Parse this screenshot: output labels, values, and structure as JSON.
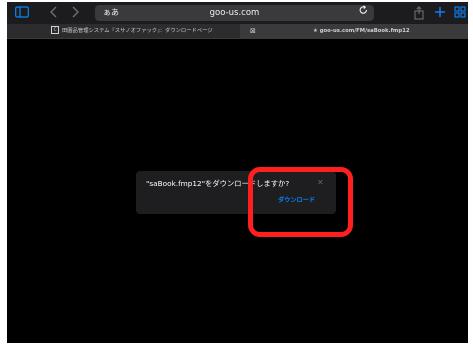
{
  "toolbar": {
    "address_aa": "ぁあ",
    "url": "goo-us.com",
    "icons": {
      "sidebar": "sidebar-icon",
      "back": "chevron-left-icon",
      "forward": "chevron-right-icon",
      "reload": "reload-icon",
      "share": "share-icon",
      "new_tab": "plus-icon",
      "tabs": "tabs-grid-icon"
    }
  },
  "tabs": [
    {
      "title": "田園品管理システム『スサノオファック』：ダウンロードページ",
      "active": false
    },
    {
      "title": "goo-us.com/FM/saBook.fmp12",
      "active": true
    }
  ],
  "dialog": {
    "message": "\"saBook.fmp12\"をダウンロードしますか?",
    "close_label": "✕",
    "action_label": "ダウンロード"
  },
  "colors": {
    "accent": "#0a84ff",
    "annotation": "#ff1f1f",
    "background": "#000000"
  }
}
